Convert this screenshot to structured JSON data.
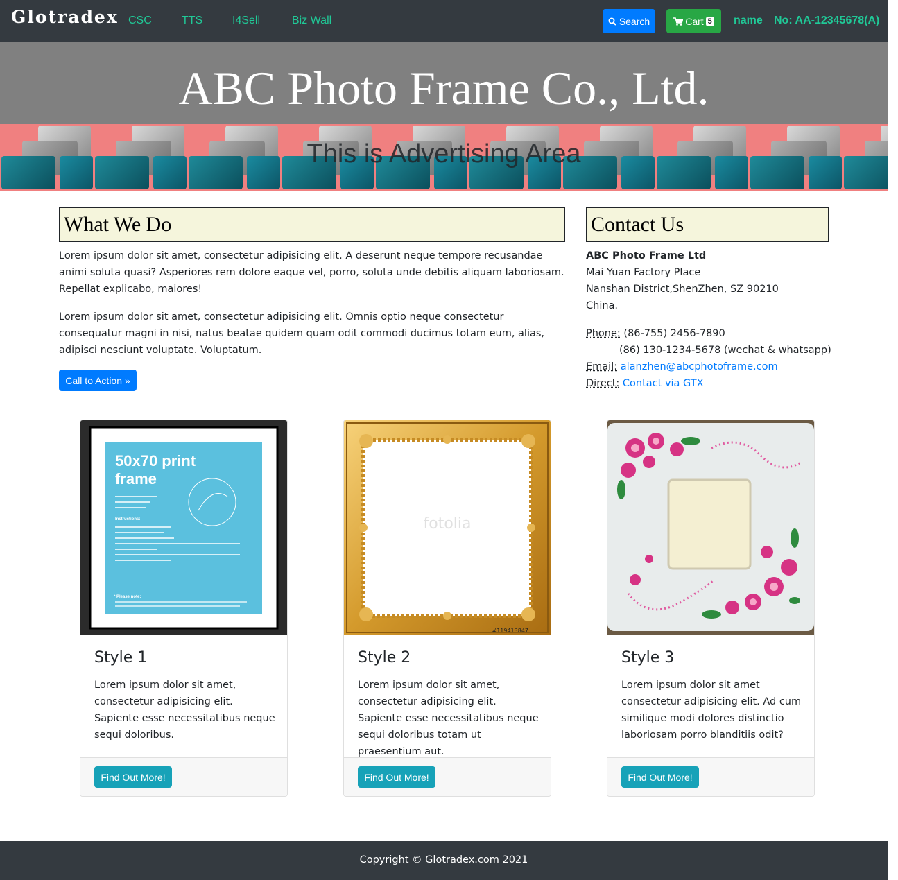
{
  "navbar": {
    "brand": "Glotradex",
    "links": [
      "CSC",
      "TTS",
      "I4Sell",
      "Biz Wall"
    ],
    "search_label": "Search",
    "cart_label": "Cart",
    "cart_count": "5",
    "user_name": "name",
    "account_no": "No: AA-12345678(A)"
  },
  "header": {
    "company_name": "ABC Photo Frame Co., Ltd."
  },
  "ad": {
    "text": "This is Advertising Area"
  },
  "what_we_do": {
    "heading": "What We Do",
    "paragraph_1": "Lorem ipsum dolor sit amet, consectetur adipisicing elit. A deserunt neque tempore recusandae animi soluta quasi? Asperiores rem dolore eaque vel, porro, soluta unde debitis aliquam laboriosam. Repellat explicabo, maiores!",
    "paragraph_2": "Lorem ipsum dolor sit amet, consectetur adipisicing elit. Omnis optio neque consectetur consequatur magni in nisi, natus beatae quidem quam odit commodi ducimus totam eum, alias, adipisci nesciunt voluptate. Voluptatum.",
    "cta_label": "Call to Action »"
  },
  "contact": {
    "heading": "Contact Us",
    "company": "ABC Photo Frame Ltd",
    "address_1": "Mai Yuan Factory Place",
    "address_2": "Nanshan District,ShenZhen, SZ 90210",
    "address_3": "China.",
    "phone_label": "Phone:",
    "phone_1": "(86-755) 2456-7890",
    "phone_2": "(86) 130-1234-5678 (wechat & whatsapp)",
    "email_label": "Email:",
    "email": "alanzhen@abcphotoframe.com",
    "direct_label": "Direct:",
    "direct_link": "Contact via GTX"
  },
  "cards": [
    {
      "title": "Style 1",
      "text": "Lorem ipsum dolor sit amet, consectetur adipisicing elit. Sapiente esse necessitatibus neque sequi doloribus.",
      "button": "Find Out More!",
      "image": {
        "headline_1": "50x70 print",
        "headline_2": "frame",
        "instructions_title": "Instructions:",
        "note": "* Please note:"
      }
    },
    {
      "title": "Style 2",
      "text": "Lorem ipsum dolor sit amet, consectetur adipisicing elit. Sapiente esse necessitatibus neque sequi doloribus totam ut praesentium aut.",
      "button": "Find Out More!",
      "image": {
        "watermark": "fotolia",
        "stock_id": "#119413847"
      }
    },
    {
      "title": "Style 3",
      "text": "Lorem ipsum dolor sit amet consectetur adipisicing elit. Ad cum similique modi dolores distinctio laboriosam porro blanditiis odit?",
      "button": "Find Out More!"
    }
  ],
  "footer": {
    "copyright": "Copyright © Glotradex.com 2021"
  },
  "colors": {
    "navbar_bg": "#343a40",
    "nav_link": "#20c997",
    "primary": "#007bff",
    "success": "#28a745",
    "info": "#17a2b8",
    "header_bg": "#808080",
    "ad_bg": "#f08080",
    "heading_bg": "#f5f5dc"
  }
}
